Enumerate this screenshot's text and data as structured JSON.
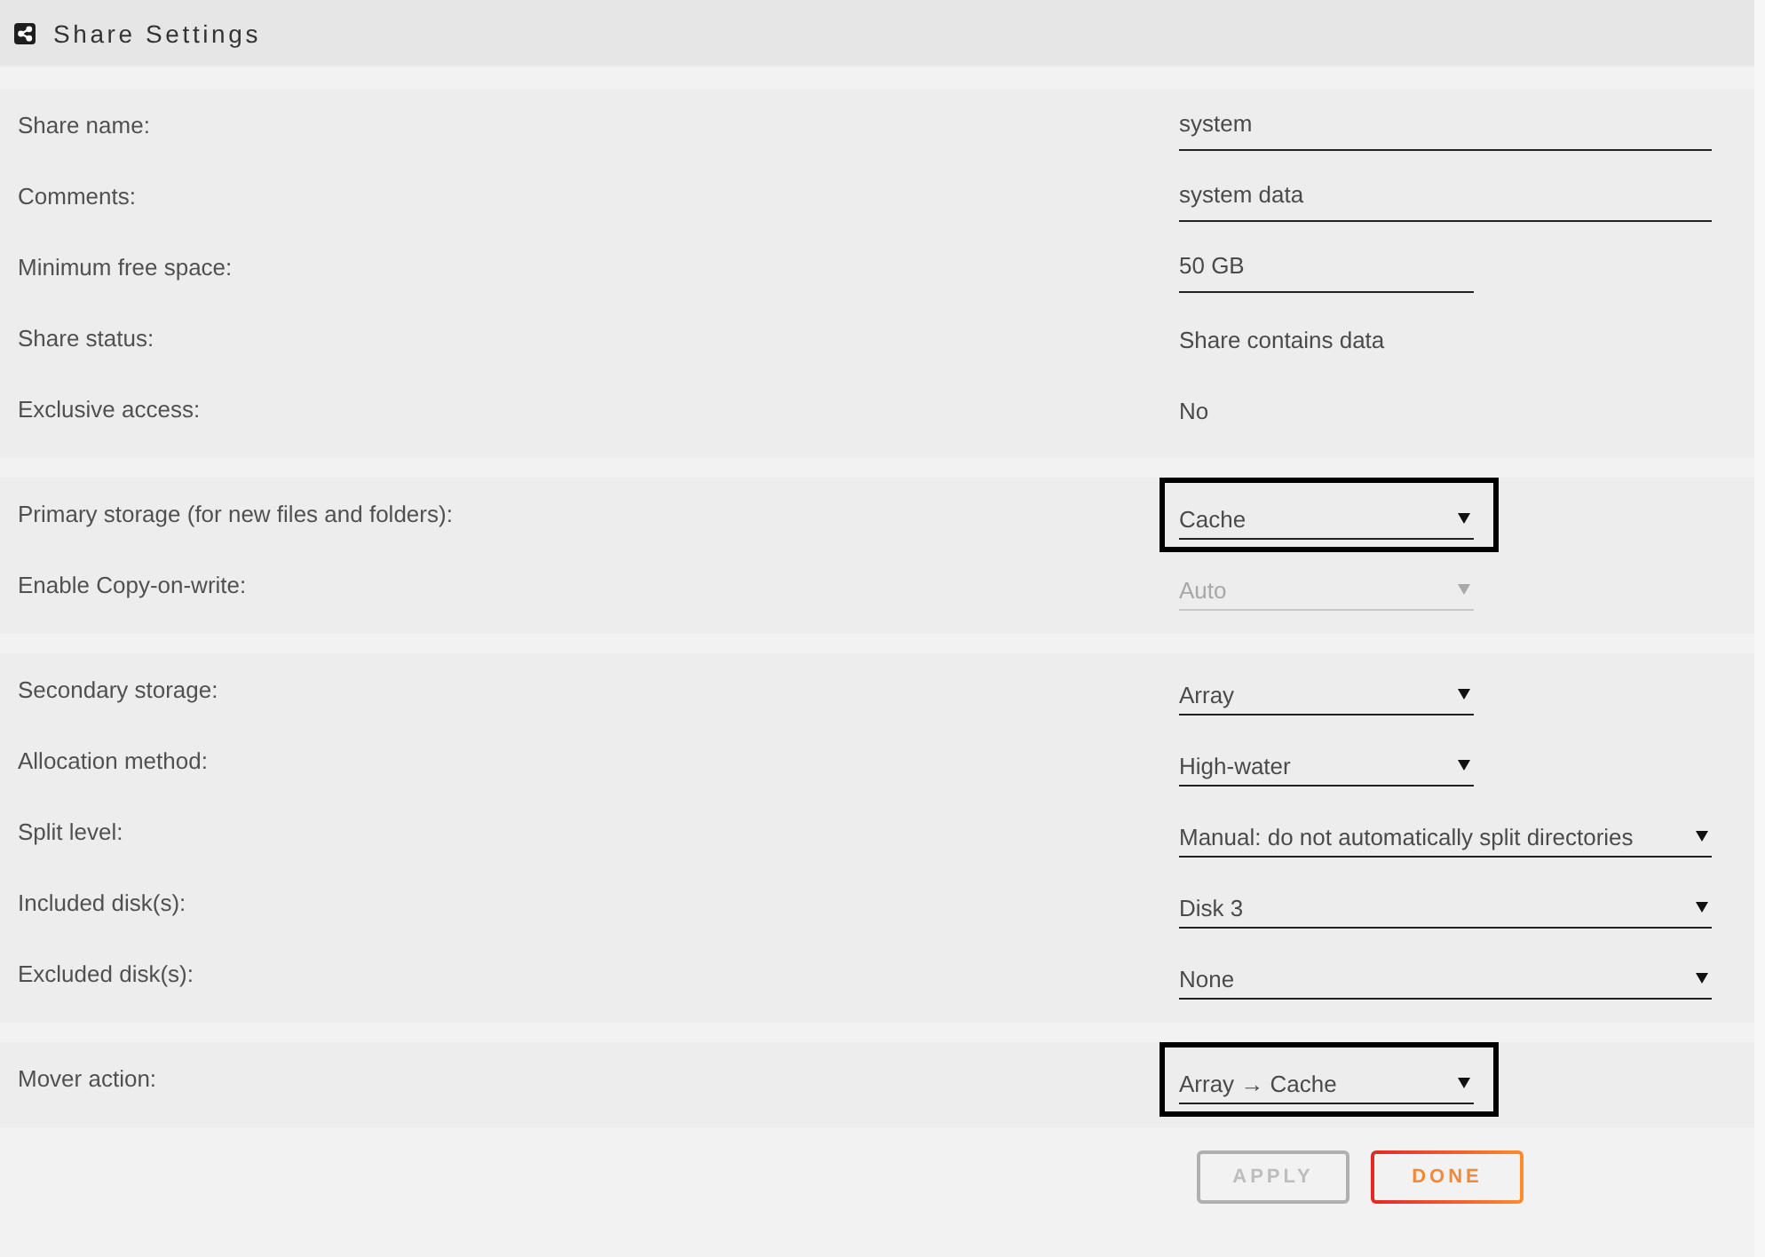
{
  "header": {
    "title": "Share Settings"
  },
  "sections": [
    {
      "rows": [
        {
          "label": "Share name:",
          "field": {
            "kind": "input",
            "value": "system",
            "wide": true,
            "disabled": false,
            "highlighted": false
          }
        },
        {
          "label": "Comments:",
          "field": {
            "kind": "input",
            "value": "system data",
            "wide": true,
            "disabled": false,
            "highlighted": false
          }
        },
        {
          "label": "Minimum free space:",
          "field": {
            "kind": "input",
            "value": "50 GB",
            "wide": false,
            "disabled": false,
            "highlighted": false
          }
        },
        {
          "label": "Share status:",
          "field": {
            "kind": "text",
            "value": "Share contains data",
            "disabled": false,
            "highlighted": false
          }
        },
        {
          "label": "Exclusive access:",
          "field": {
            "kind": "text",
            "value": "No",
            "disabled": false,
            "highlighted": false
          }
        }
      ]
    },
    {
      "rows": [
        {
          "label": "Primary storage (for new files and folders):",
          "field": {
            "kind": "select",
            "value": "Cache",
            "wide": false,
            "disabled": false,
            "highlighted": true
          }
        },
        {
          "label": "Enable Copy-on-write:",
          "field": {
            "kind": "select",
            "value": "Auto",
            "wide": false,
            "disabled": true,
            "highlighted": false
          }
        }
      ]
    },
    {
      "rows": [
        {
          "label": "Secondary storage:",
          "field": {
            "kind": "select",
            "value": "Array",
            "wide": false,
            "disabled": false,
            "highlighted": false
          }
        },
        {
          "label": "Allocation method:",
          "field": {
            "kind": "select",
            "value": "High-water",
            "wide": false,
            "disabled": false,
            "highlighted": false
          }
        },
        {
          "label": "Split level:",
          "field": {
            "kind": "select",
            "value": "Manual: do not automatically split directories",
            "wide": true,
            "disabled": false,
            "highlighted": false
          }
        },
        {
          "label": "Included disk(s):",
          "field": {
            "kind": "select",
            "value": "Disk 3",
            "wide": true,
            "disabled": false,
            "highlighted": false
          }
        },
        {
          "label": "Excluded disk(s):",
          "field": {
            "kind": "select",
            "value": "None",
            "wide": true,
            "disabled": false,
            "highlighted": false
          }
        }
      ]
    },
    {
      "rows": [
        {
          "label": "Mover action:",
          "field": {
            "kind": "select",
            "value": "Array → Cache",
            "wide": false,
            "disabled": false,
            "highlighted": true
          }
        }
      ]
    }
  ],
  "buttons": [
    {
      "label": "APPLY",
      "disabled": true
    },
    {
      "label": "DONE",
      "disabled": false
    }
  ]
}
